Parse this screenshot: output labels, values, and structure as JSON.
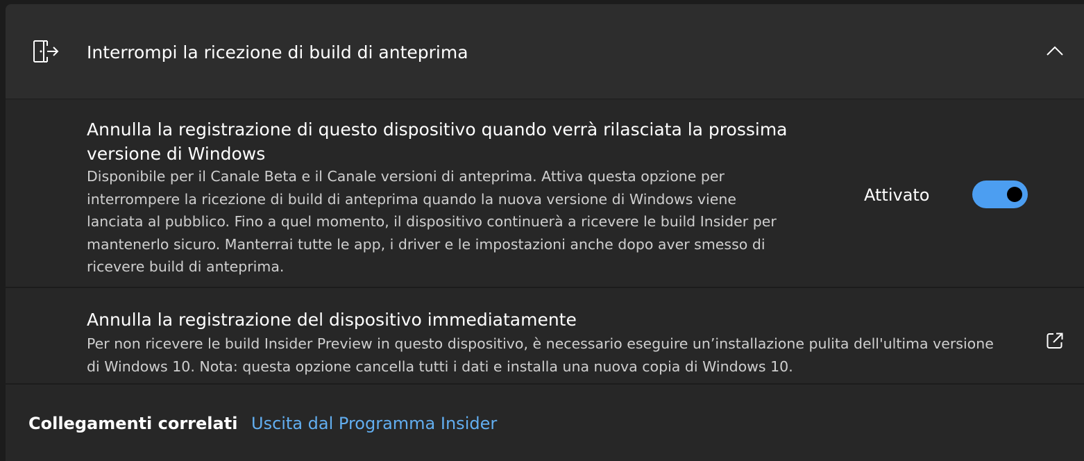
{
  "header": {
    "icon": "leave-door-icon",
    "title": "Interrompi la ricezione di build di anteprima",
    "collapse_icon": "chevron-up-icon"
  },
  "unenroll_next_release": {
    "title": "Annulla la registrazione di questo dispositivo quando verrà rilasciata la prossima versione di Windows",
    "description": "Disponibile per il Canale Beta e il Canale versioni di anteprima. Attiva questa opzione per interrompere la ricezione di build di anteprima quando la nuova versione di Windows viene lanciata al pubblico. Fino a quel momento, il dispositivo continuerà a ricevere le build Insider per mantenerlo sicuro. Manterrai tutte le app, i driver e le impostazioni anche dopo aver smesso di ricevere build di anteprima.",
    "toggle_label": "Attivato",
    "toggle_on": true
  },
  "unenroll_immediately": {
    "title": "Annulla la registrazione del dispositivo immediatamente",
    "description": "Per non ricevere le build Insider Preview in questo dispositivo, è necessario eseguire un’installazione pulita dell'ultima versione di Windows 10. Nota: questa opzione cancella tutti i dati e installa una nuova copia di Windows 10.",
    "icon": "open-external-icon"
  },
  "related_links": {
    "label": "Collegamenti correlati",
    "link": "Uscita dal Programma Insider"
  },
  "colors": {
    "accent": "#4c9ef1",
    "link": "#62aef0",
    "background": "#1c1c1c",
    "card": "#272727",
    "header": "#2d2d2d"
  }
}
